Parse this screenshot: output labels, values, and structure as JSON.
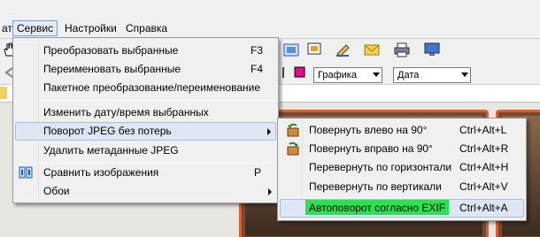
{
  "menubar": {
    "items": [
      {
        "label": "ать"
      },
      {
        "label": "Сервис"
      },
      {
        "label": "Настройки"
      },
      {
        "label": "Справка"
      }
    ]
  },
  "toolbar": {
    "combos": [
      {
        "value": "Графика"
      },
      {
        "value": "Дата"
      }
    ]
  },
  "service_menu": {
    "items": [
      {
        "label": "Преобразовать выбранные",
        "shortcut": "F3"
      },
      {
        "label": "Переименовать выбранные",
        "shortcut": "F4"
      },
      {
        "label": "Пакетное преобразование/переименование",
        "shortcut": ""
      },
      {
        "label": "Изменить дату/время выбранных",
        "shortcut": ""
      },
      {
        "label": "Поворот JPEG без потерь",
        "shortcut": ""
      },
      {
        "label": "Удалить метаданные JPEG",
        "shortcut": ""
      },
      {
        "label": "Сравнить изображения",
        "shortcut": "P"
      },
      {
        "label": "Обои",
        "shortcut": ""
      }
    ]
  },
  "rotate_submenu": {
    "items": [
      {
        "label": "Повернуть влево на 90°",
        "shortcut": "Ctrl+Alt+L"
      },
      {
        "label": "Повернуть вправо на 90°",
        "shortcut": "Ctrl+Alt+R"
      },
      {
        "label": "Перевернуть по горизонтали",
        "shortcut": "Ctrl+Alt+H"
      },
      {
        "label": "Перевернуть по вертикали",
        "shortcut": "Ctrl+Alt+V"
      },
      {
        "label": "Автоповорот согласно EXIF",
        "shortcut": "Ctrl+Alt+A"
      }
    ]
  },
  "colors": {
    "highlight_exif": "#2ce14e",
    "thumb_border": "#e05a2a",
    "menu_bg": "#f0f0f0"
  }
}
